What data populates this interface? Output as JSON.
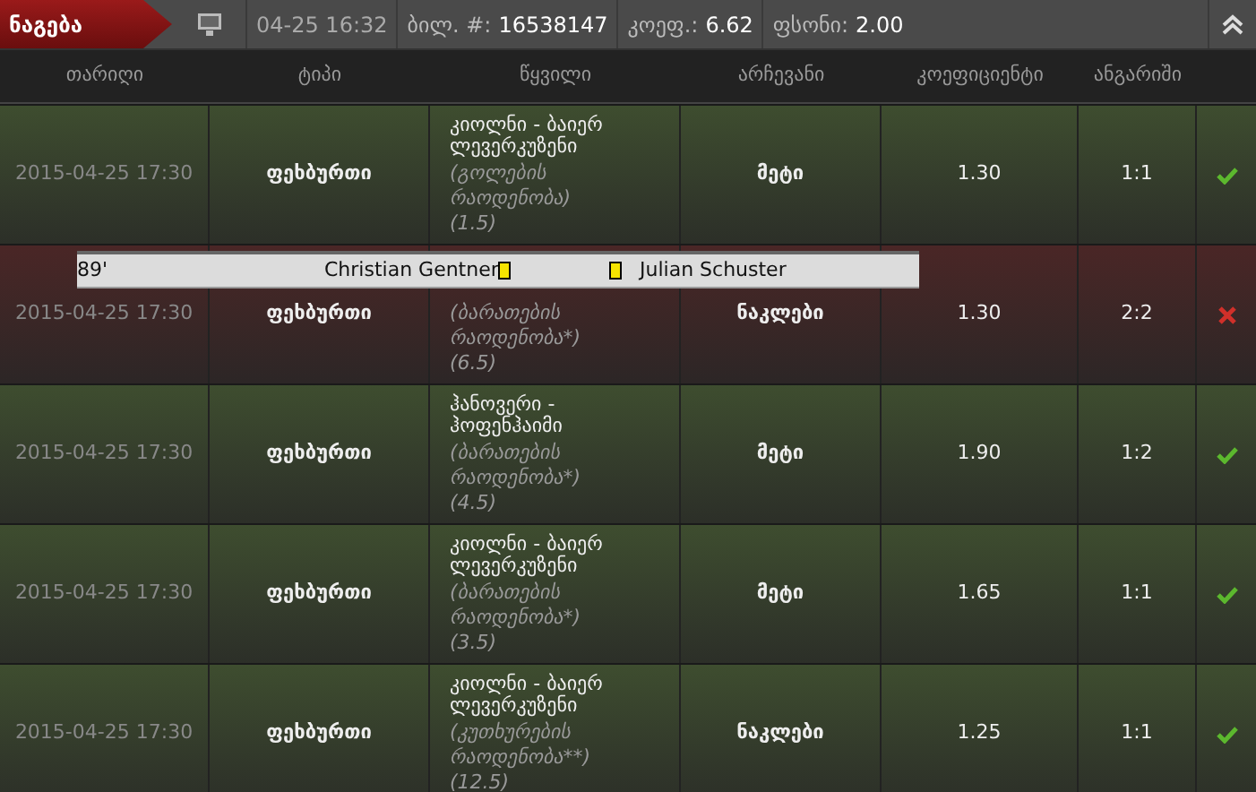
{
  "top_bar": {
    "tab": "ნაგება",
    "time": "04-25 16:32",
    "ticket_label": "ბილ. #:",
    "ticket": "16538147",
    "coef_label": "კოეფ.:",
    "coef": "6.62",
    "stake_label": "ფსონი:",
    "stake": "2.00"
  },
  "columns": [
    "თარიღი",
    "ტიპი",
    "წყვილი",
    "არჩევანი",
    "კოეფიციენტი",
    "ანგარიში"
  ],
  "rows": [
    {
      "date": "2015-04-25 17:30",
      "type": "ფეხბურთი",
      "match": "კიოლნი - ბაიერ ლევერკუზენი",
      "market": "(გოლების რაოდენობა)",
      "line": "(1.5)",
      "choice": "მეტი",
      "coef": "1.30",
      "score": "1:1",
      "won": true
    },
    {
      "date": "2015-04-25 17:30",
      "type": "ფეხბურთი",
      "market": "(ბარათების რაოდენობა*)",
      "line": "(6.5)",
      "choice": "ნაკლები",
      "coef": "1.30",
      "score": "2:2",
      "won": false
    },
    {
      "date": "2015-04-25 17:30",
      "type": "ფეხბურთი",
      "match": "ჰანოვერი - ჰოფენჰაიმი",
      "market": "(ბარათების რაოდენობა*)",
      "line": "(4.5)",
      "choice": "მეტი",
      "coef": "1.90",
      "score": "1:2",
      "won": true
    },
    {
      "date": "2015-04-25 17:30",
      "type": "ფეხბურთი",
      "match": "კიოლნი - ბაიერ ლევერკუზენი",
      "market": "(ბარათების რაოდენობა*)",
      "line": "(3.5)",
      "choice": "მეტი",
      "coef": "1.65",
      "score": "1:1",
      "won": true
    },
    {
      "date": "2015-04-25 17:30",
      "type": "ფეხბურთი",
      "match": "კიოლნი - ბაიერ ლევერკუზენი",
      "market": "(კუთხურების რაოდენობა**)",
      "line": "(12.5)",
      "choice": "ნაკლები",
      "coef": "1.25",
      "score": "1:1",
      "won": true
    }
  ],
  "popup": {
    "minute": "89'",
    "player_1": "Christian Gentner",
    "player_2": "Julian Schuster"
  }
}
